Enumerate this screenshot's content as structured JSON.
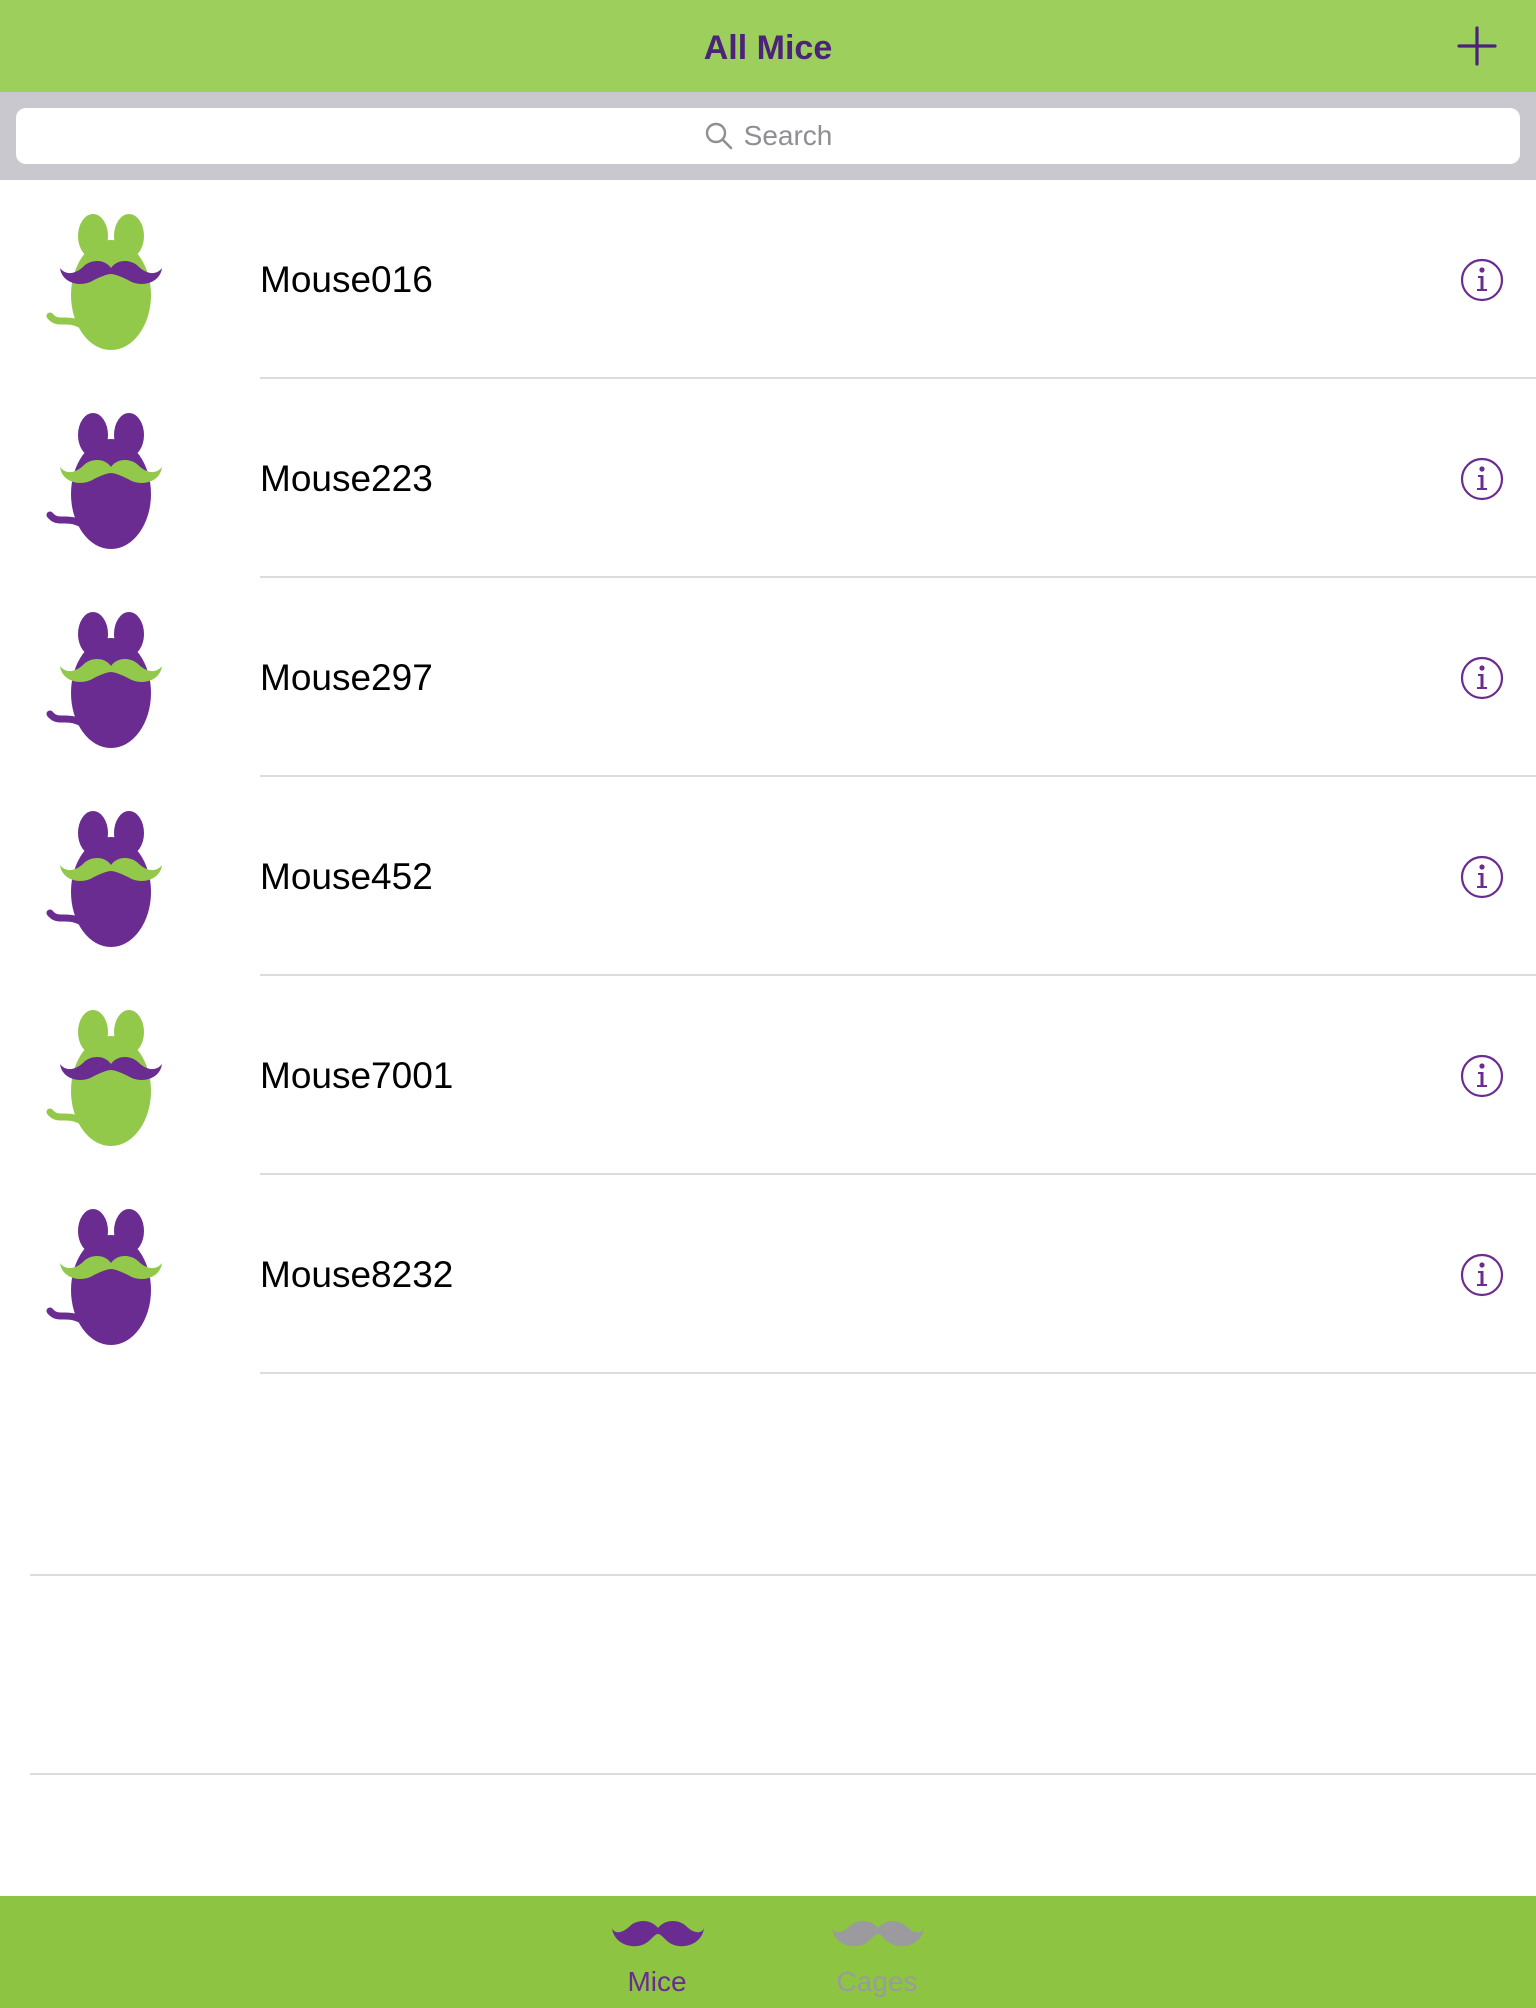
{
  "colors": {
    "navbar": "#9ccf5b",
    "tabbar": "#8dc543",
    "accent_purple": "#6a2c91",
    "mouse_green": "#92c94a",
    "tab_inactive": "#9a9a9f"
  },
  "navbar": {
    "title": "All Mice",
    "add_icon": "plus-icon"
  },
  "search": {
    "placeholder": "Search",
    "icon": "magnifying-glass-icon"
  },
  "mice": [
    {
      "name": "Mouse016",
      "avatar": "green-mouse-purple-mustache",
      "info_icon": "info-icon"
    },
    {
      "name": "Mouse223",
      "avatar": "purple-mouse-green-mustache",
      "info_icon": "info-icon"
    },
    {
      "name": "Mouse297",
      "avatar": "purple-mouse-green-mustache",
      "info_icon": "info-icon"
    },
    {
      "name": "Mouse452",
      "avatar": "purple-mouse-green-mustache",
      "info_icon": "info-icon"
    },
    {
      "name": "Mouse7001",
      "avatar": "green-mouse-purple-mustache",
      "info_icon": "info-icon"
    },
    {
      "name": "Mouse8232",
      "avatar": "purple-mouse-green-mustache",
      "info_icon": "info-icon"
    }
  ],
  "tabbar": {
    "tabs": [
      {
        "label": "Mice",
        "icon": "mustache-icon",
        "selected": true
      },
      {
        "label": "Cages",
        "icon": "mustache-icon",
        "selected": false
      }
    ]
  }
}
